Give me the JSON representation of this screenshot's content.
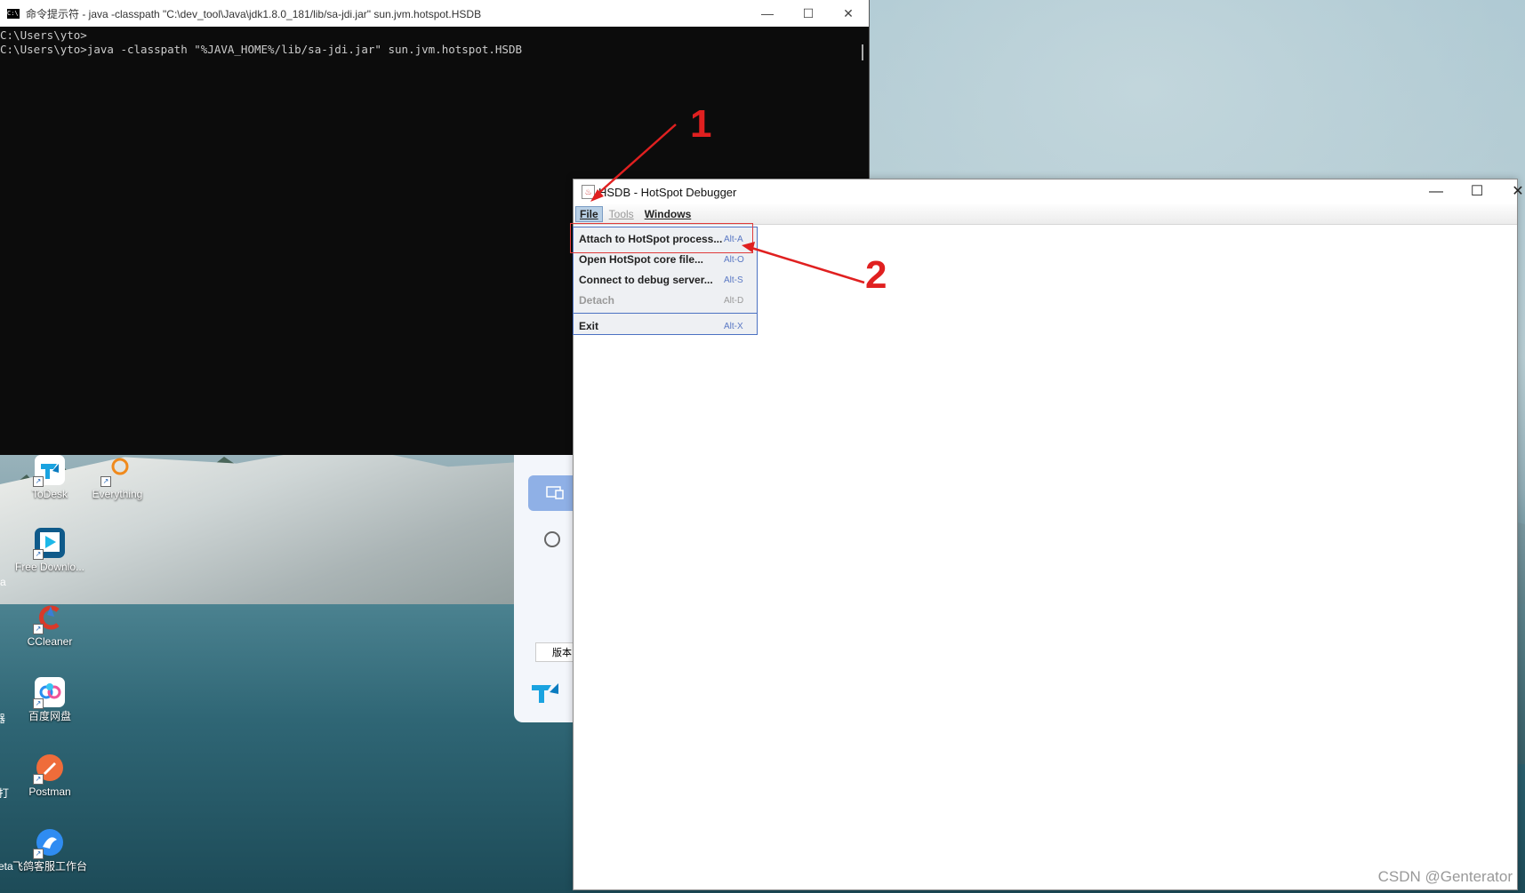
{
  "cmd": {
    "title": "命令提示符 - java  -classpath \"C:\\dev_tool\\Java\\jdk1.8.0_181/lib/sa-jdi.jar\" sun.jvm.hotspot.HSDB",
    "icon_label": "C:\\",
    "lines": [
      "C:\\Users\\yto>",
      "C:\\Users\\yto>java -classpath \"%JAVA_HOME%/lib/sa-jdi.jar\" sun.jvm.hotspot.HSDB"
    ],
    "minimize": "—",
    "maximize": "☐",
    "close": "✕"
  },
  "hsdb": {
    "title": "HSDB - HotSpot Debugger",
    "menus": [
      {
        "label": "File",
        "state": "selected"
      },
      {
        "label": "Tools",
        "state": "disabled"
      },
      {
        "label": "Windows",
        "state": "enabled"
      }
    ],
    "file_menu": [
      {
        "label": "Attach to HotSpot process...",
        "accel": "Alt-A"
      },
      {
        "label": "Open HotSpot core file...",
        "accel": "Alt-O"
      },
      {
        "label": "Connect to debug server...",
        "accel": "Alt-S"
      },
      {
        "label": "Detach",
        "accel": "Alt-D",
        "disabled": true
      },
      {
        "label": "Exit",
        "accel": "Alt-X"
      }
    ],
    "minimize": "—",
    "maximize": "☐",
    "close": "✕"
  },
  "desktop_icons": [
    {
      "label": "ToDesk",
      "icon": "todesk-icon"
    },
    {
      "label": "Everything",
      "icon": "everything-icon"
    },
    {
      "label": "Free Downlo...",
      "icon": "free-download-icon"
    },
    {
      "label": "CCleaner",
      "icon": "ccleaner-icon"
    },
    {
      "label": "百度网盘",
      "icon": "baidu-netdisk-icon"
    },
    {
      "label": "Postman",
      "icon": "postman-icon"
    },
    {
      "label": "飞鸽客服工作台",
      "icon": "feige-icon"
    }
  ],
  "edge_fragments": {
    "left_a": "a",
    "left_b": "器",
    "left_c": "打",
    "left_d": "eta"
  },
  "panel": {
    "version_label": "版本"
  },
  "annotations": {
    "one": "1",
    "two": "2"
  },
  "watermark": "CSDN @Genterator",
  "colors": {
    "annotation_red": "#e02020",
    "menu_selection": "#b8cfe5",
    "menu_border": "#4c72c2"
  }
}
